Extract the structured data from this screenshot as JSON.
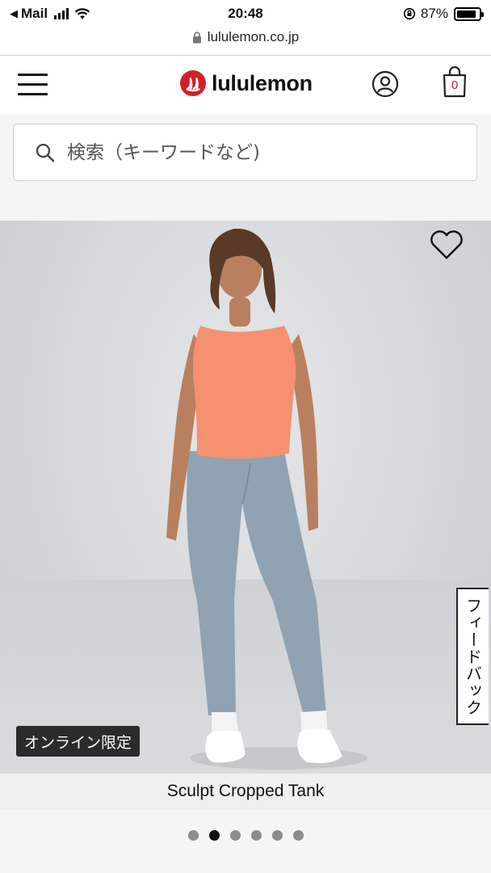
{
  "status_bar": {
    "back_app": "Mail",
    "time": "20:48",
    "battery_pct": "87%",
    "battery_level": 0.87
  },
  "browser": {
    "url": "lululemon.co.jp"
  },
  "header": {
    "brand": "lululemon",
    "cart_count": "0"
  },
  "search": {
    "placeholder": "検索（キーワードなど)"
  },
  "product": {
    "badge": "オンライン限定",
    "name": "Sculpt Cropped Tank",
    "image_count": 6,
    "active_image": 2
  },
  "feedback": {
    "label": "フィードバック"
  },
  "colors": {
    "brand_red": "#d31f2a",
    "tank": "#f5916f",
    "leggings": "#8fa3b3"
  }
}
